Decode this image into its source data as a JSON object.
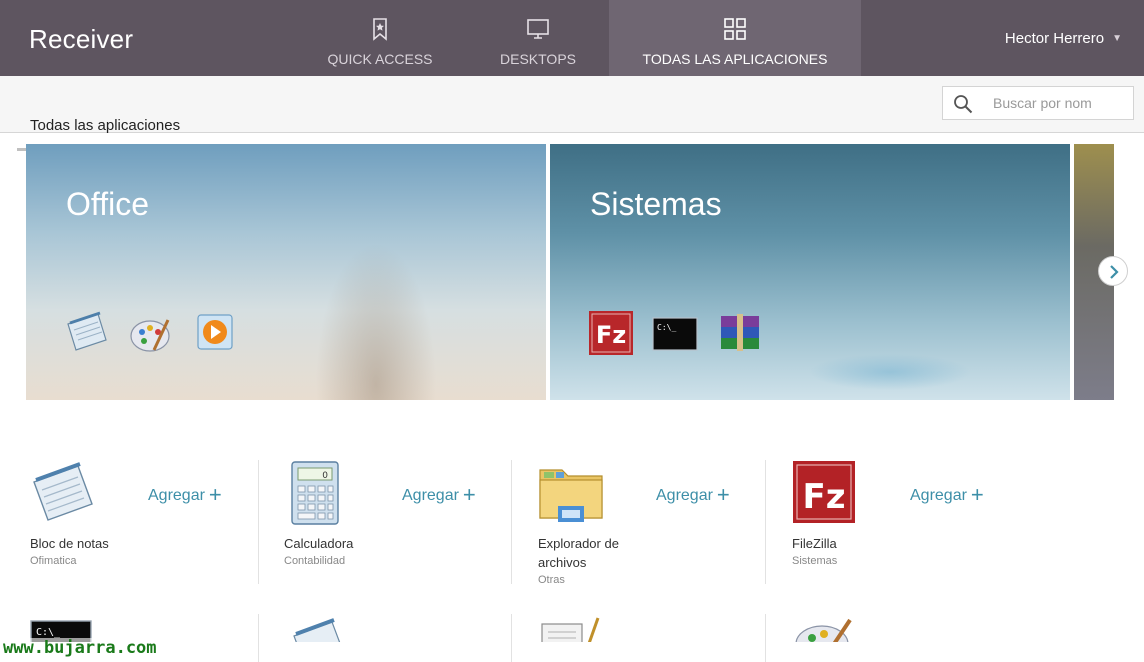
{
  "header": {
    "brand": "Receiver",
    "tabs": [
      {
        "label": "QUICK ACCESS",
        "icon": "bookmark-icon",
        "active": false
      },
      {
        "label": "DESKTOPS",
        "icon": "monitor-icon",
        "active": false
      },
      {
        "label": "TODAS LAS APLICACIONES",
        "icon": "grid-icon",
        "active": true
      }
    ],
    "user": "Hector Herrero"
  },
  "subheader": {
    "title": "Todas las aplicaciones",
    "search_placeholder": "Buscar por nom"
  },
  "categories": [
    {
      "title": "Office",
      "icons": [
        "notepad-icon",
        "paint-icon",
        "media-player-icon"
      ]
    },
    {
      "title": "Sistemas",
      "icons": [
        "filezilla-icon",
        "cmd-icon",
        "winrar-icon"
      ]
    }
  ],
  "apps": [
    {
      "name": "Bloc de notas",
      "category": "Ofimatica",
      "icon": "notepad-icon",
      "add_label": "Agregar"
    },
    {
      "name": "Calculadora",
      "category": "Contabilidad",
      "icon": "calculator-icon",
      "add_label": "Agregar"
    },
    {
      "name": "Explorador de archivos",
      "category": "Otras",
      "icon": "file-explorer-icon",
      "add_label": "Agregar"
    },
    {
      "name": "FileZilla",
      "category": "Sistemas",
      "icon": "filezilla-icon",
      "add_label": "Agregar"
    }
  ],
  "watermark": "www.bujarra.com",
  "colors": {
    "topbar": "#5e5560",
    "active_tab": "#6f6672",
    "accent": "#3d8fa8"
  }
}
